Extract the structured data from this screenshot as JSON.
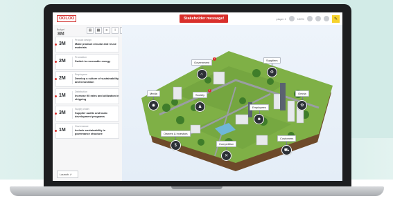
{
  "app": {
    "logo": "OOLOO",
    "stakeholder_button": "Stakeholder message!",
    "top_right": {
      "user": "player 1",
      "score_label": "100%"
    }
  },
  "sidebar": {
    "budget_label": "Budget",
    "budget_value": "8M",
    "tools": [
      "doc-icon",
      "grid-icon",
      "list-icon",
      "info-icon",
      "search-icon"
    ],
    "cards": [
      {
        "amount": "3M",
        "category": "Product design",
        "title": "Make product circular and reuse materials"
      },
      {
        "amount": "2M",
        "category": "Production",
        "title": "Switch to renewable energy"
      },
      {
        "amount": "2M",
        "category": "Employees",
        "title": "Develop a culture of sustainability and innovation"
      },
      {
        "amount": "1M",
        "category": "Distribution",
        "title": "Increase fill rates and utilization in shipping"
      },
      {
        "amount": "3M",
        "category": "Supply chain",
        "title": "Supplier audits and basic development programs"
      },
      {
        "amount": "1M",
        "category": "Governance",
        "title": "Include sustainability in governance structure"
      }
    ],
    "launch_label": "Launch"
  },
  "map": {
    "stakeholders": [
      {
        "name": "Government",
        "icon": "government-icon"
      },
      {
        "name": "Suppliers",
        "icon": "suppliers-icon"
      },
      {
        "name": "Media",
        "icon": "media-icon"
      },
      {
        "name": "Society",
        "icon": "society-icon"
      },
      {
        "name": "Employees",
        "icon": "employees-icon"
      },
      {
        "name": "Owners & investors",
        "icon": "owners-icon"
      },
      {
        "name": "Competition",
        "icon": "competition-icon"
      },
      {
        "name": "Customers",
        "icon": "customers-icon"
      },
      {
        "name": "Omnia",
        "icon": "omnia-icon"
      }
    ]
  },
  "colors": {
    "accent": "#d92f2b",
    "highlight": "#f6d22b",
    "pin": "#2c3036",
    "island_grass": "#7fb046"
  }
}
